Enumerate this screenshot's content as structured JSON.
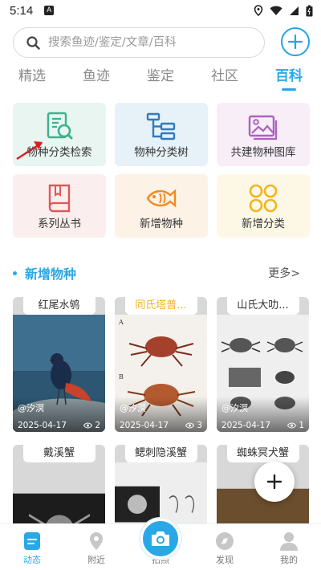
{
  "status_bar": {
    "time": "5:14",
    "notification_letter": "A"
  },
  "search": {
    "placeholder": "搜索鱼迹/鉴定/文章/百科"
  },
  "tabs": [
    {
      "label": "精选",
      "active": false
    },
    {
      "label": "鱼迹",
      "active": false
    },
    {
      "label": "鉴定",
      "active": false
    },
    {
      "label": "社区",
      "active": false
    },
    {
      "label": "百科",
      "active": true
    }
  ],
  "grid": [
    {
      "label": "物种分类检索",
      "icon": "species-search-icon"
    },
    {
      "label": "物种分类树",
      "icon": "tree-icon"
    },
    {
      "label": "共建物种图库",
      "icon": "gallery-icon"
    },
    {
      "label": "系列丛书",
      "icon": "book-icon"
    },
    {
      "label": "新增物种",
      "icon": "fish-icon"
    },
    {
      "label": "新增分类",
      "icon": "grid-flower-icon"
    }
  ],
  "section": {
    "title": "新增物种",
    "more": "更多>"
  },
  "species": [
    {
      "name": "红尾水鸲",
      "author": "@汐溟",
      "date": "2025-04-17",
      "views": "2"
    },
    {
      "name": "同氏塔普...",
      "author": "@汐溟",
      "date": "2025-04-17",
      "views": "3"
    },
    {
      "name": "山氏大叻...",
      "author": "@汐溟",
      "date": "2025-04-17",
      "views": "1"
    },
    {
      "name": "戴溪蟹"
    },
    {
      "name": "鳃刺隐溪蟹"
    },
    {
      "name": "蜘蛛冥犬蟹"
    }
  ],
  "nav": [
    {
      "label": "动态",
      "active": true
    },
    {
      "label": "附近",
      "active": false
    },
    {
      "label": "拍照",
      "active": false
    },
    {
      "label": "发现",
      "active": false
    },
    {
      "label": "我的",
      "active": false
    }
  ],
  "colors": {
    "accent": "#2aa7e6",
    "highlight_tag": "#f2b51b"
  }
}
